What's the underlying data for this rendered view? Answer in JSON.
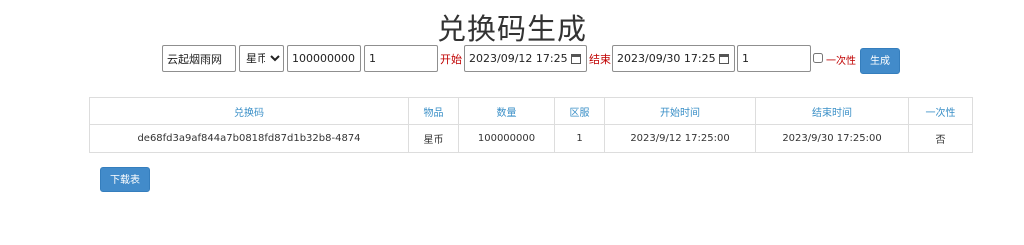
{
  "page": {
    "title": "兑换码生成"
  },
  "form": {
    "name_value": "云起烟雨网",
    "item_options": [
      "星币"
    ],
    "item_selected": "星币",
    "amount_value": "100000000",
    "server_value": "1",
    "start_label": "开始",
    "start_value": "2023/09/12  17:25",
    "end_label": "结束",
    "end_value": "2023/09/30  17:25",
    "count_value": "1",
    "once_label": "一次性",
    "generate_label": "生成"
  },
  "table": {
    "headers": [
      "兑换码",
      "物品",
      "数量",
      "区服",
      "开始时间",
      "结束时间",
      "一次性"
    ],
    "rows": [
      [
        "de68fd3a9af844a7b0818fd87d1b32b8-4874",
        "星币",
        "100000000",
        "1",
        "2023/9/12 17:25:00",
        "2023/9/30 17:25:00",
        "否"
      ]
    ]
  },
  "download_label": "下载表",
  "colors": {
    "accent": "#428bca",
    "header_text": "#3a8fc7",
    "label_red": "#c00000"
  }
}
